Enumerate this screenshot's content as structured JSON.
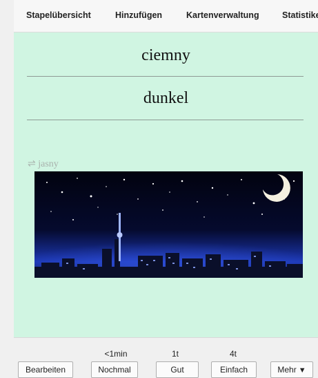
{
  "topbar": {
    "items": [
      "Stapelübersicht",
      "Hinzufügen",
      "Kartenverwaltung",
      "Statistiken"
    ]
  },
  "card": {
    "front": "ciemny",
    "back": "dunkel",
    "hint_arrow": "⇌",
    "hint_text": "jasny",
    "image_desc_colors": {
      "sky": "#02051a",
      "city_glow": "#1f3fbf",
      "moon": "#f4f0e0"
    }
  },
  "answer_bar": {
    "intervals": [
      "<1min",
      "1t",
      "4t"
    ],
    "buttons": {
      "edit": "Bearbeiten",
      "again": "Nochmal",
      "good": "Gut",
      "easy": "Einfach",
      "more": "Mehr",
      "more_arrow": "▼"
    }
  },
  "colors": {
    "card_bg": "#d0f5e2",
    "bar_bg": "#f0f0f0"
  }
}
